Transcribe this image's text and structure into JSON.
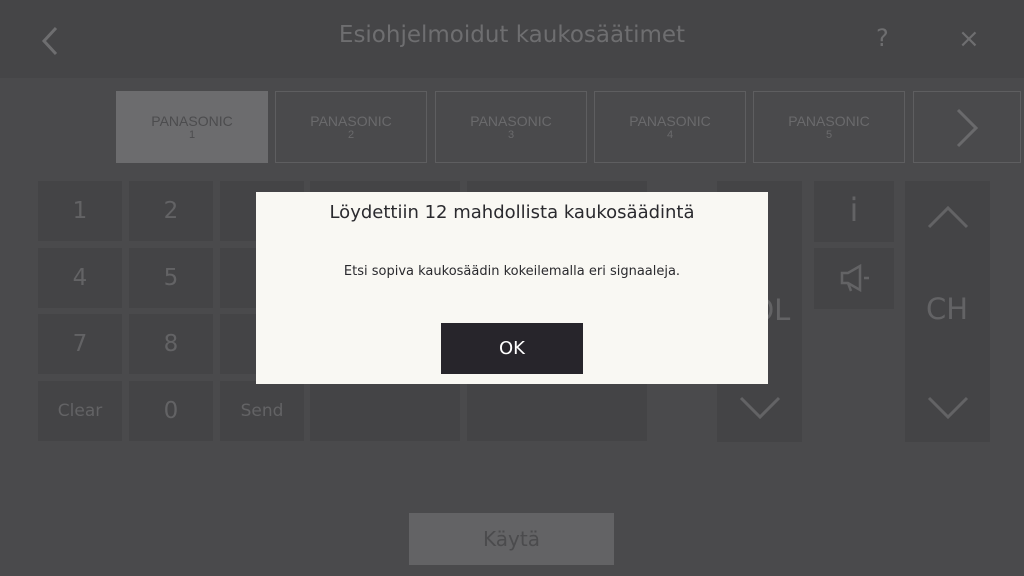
{
  "header": {
    "title": "Esiohjelmoidut kaukosäätimet",
    "help_label": "?",
    "close_label": "×"
  },
  "tabs": [
    {
      "brand": "PANASONIC",
      "number": "1",
      "active": true
    },
    {
      "brand": "PANASONIC",
      "number": "2"
    },
    {
      "brand": "PANASONIC",
      "number": "3"
    },
    {
      "brand": "PANASONIC",
      "number": "4"
    },
    {
      "brand": "PANASONIC",
      "number": "5"
    }
  ],
  "keypad": {
    "k1": "1",
    "k2": "2",
    "k4": "4",
    "k5": "5",
    "k7": "7",
    "k8": "8",
    "clear": "Clear",
    "zero": "0",
    "send": "Send"
  },
  "controls": {
    "info": "i",
    "vol_label": "VOL",
    "ch_label": "CH"
  },
  "footer": {
    "use_label": "Käytä"
  },
  "dialog": {
    "title": "Löydettiin 12 mahdollista kaukosäädintä",
    "message": "Etsi sopiva kaukosäädin kokeilemalla eri signaaleja.",
    "ok_label": "OK"
  }
}
